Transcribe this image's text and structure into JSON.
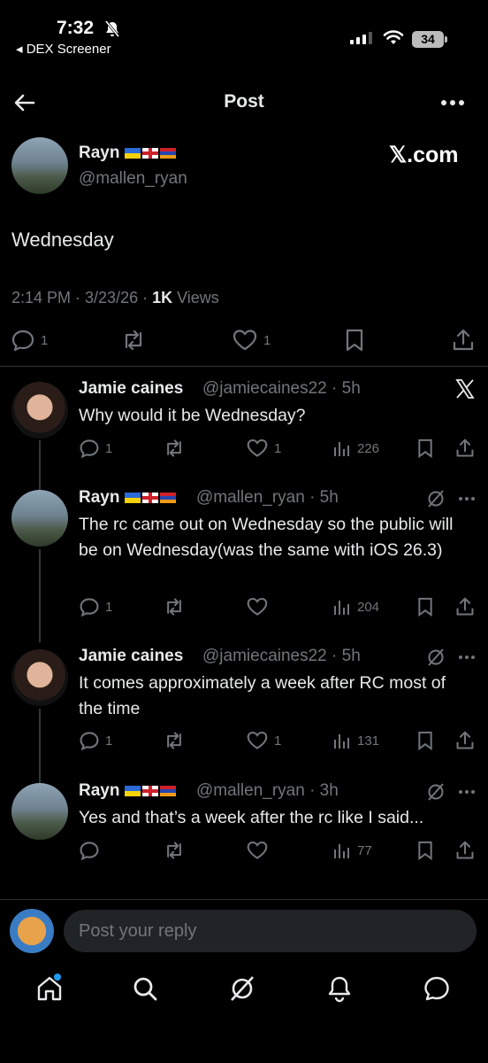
{
  "status_bar": {
    "time": "7:32",
    "back_app": "◂ DEX Screener",
    "battery": "34"
  },
  "header": {
    "title": "Post"
  },
  "main_post": {
    "author": "Rayn",
    "handle": "@mallen_ryan",
    "watermark": "𝕏.com",
    "text": "Wednesday",
    "time_date": "2:14 PM · 3/23/26 · ",
    "views_count": "1K",
    "views_label": " Views",
    "replies": "1",
    "likes": "1"
  },
  "replies": [
    {
      "author": "Jamie caines",
      "handle": "@jamiecaines22 · 5h",
      "text": "Why would it be Wednesday?",
      "replies": "1",
      "likes": "1",
      "views": "226"
    },
    {
      "author": "Rayn",
      "handle": "@mallen_ryan · 5h",
      "text": "The rc came out on Wednesday so the public will be on Wednesday(was the same with iOS 26.3)",
      "replies": "1",
      "likes": "",
      "views": "204"
    },
    {
      "author": "Jamie caines",
      "handle": "@jamiecaines22 · 5h",
      "text": "It comes approximately a week after RC most of the time",
      "replies": "1",
      "likes": "1",
      "views": "131"
    },
    {
      "author": "Rayn",
      "handle": "@mallen_ryan · 3h",
      "text": "Yes and that’s a week after the rc like I said...",
      "replies": "",
      "likes": "",
      "views": "77"
    }
  ],
  "composer": {
    "placeholder": "Post your reply"
  },
  "icons": {
    "status": [
      "bell-off-icon",
      "signal-icon",
      "wifi-icon",
      "battery-icon"
    ],
    "header": [
      "back-arrow-icon",
      "more-icon"
    ],
    "actions": [
      "reply-icon",
      "repost-icon",
      "like-icon",
      "views-icon",
      "bookmark-icon",
      "share-icon"
    ],
    "reply_header": [
      "x-logo-icon",
      "grok-icon",
      "more-icon"
    ],
    "nav": [
      "home-icon",
      "search-icon",
      "grok-icon",
      "notifications-icon",
      "messages-icon"
    ]
  },
  "colors": {
    "background": "#000000",
    "text": "#e7e9ea",
    "muted": "#71767b",
    "accent": "#1d9bf0",
    "divider": "#2f3336"
  }
}
